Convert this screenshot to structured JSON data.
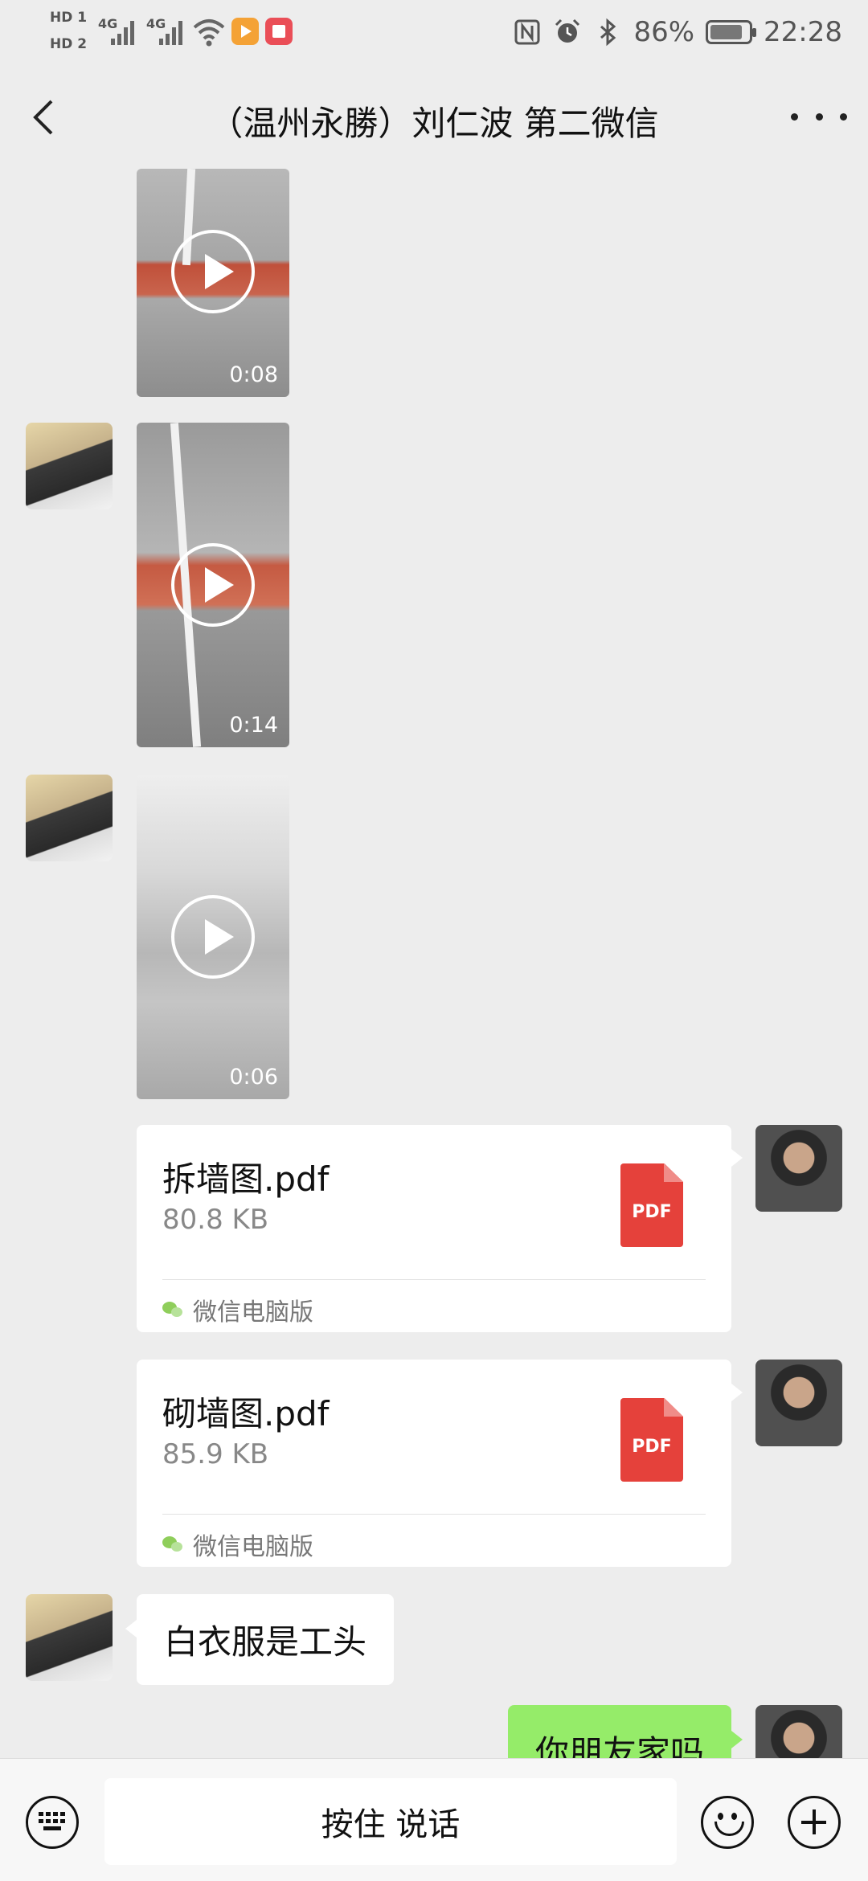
{
  "status_bar": {
    "hd1": "HD 1",
    "hd2": "HD 2",
    "net1": "4G",
    "net2": "4G",
    "battery_percent": "86%",
    "battery_level": 0.86,
    "time": "22:28",
    "icons": [
      "hd-icon",
      "signal-icon",
      "wifi-icon",
      "app-notification-icon",
      "nfc-icon",
      "alarm-icon",
      "bluetooth-icon",
      "battery-icon"
    ]
  },
  "header": {
    "title": "（温州永勝）刘仁波 第二微信"
  },
  "messages": [
    {
      "type": "video",
      "side": "left",
      "duration": "0:08"
    },
    {
      "type": "video",
      "side": "left",
      "duration": "0:14"
    },
    {
      "type": "video",
      "side": "left",
      "duration": "0:06"
    },
    {
      "type": "file",
      "side": "right",
      "name": "拆墙图.pdf",
      "size": "80.8 KB",
      "icon_label": "PDF",
      "source": "微信电脑版"
    },
    {
      "type": "file",
      "side": "right",
      "name": "砌墙图.pdf",
      "size": "85.9 KB",
      "icon_label": "PDF",
      "source": "微信电脑版"
    },
    {
      "type": "text",
      "side": "left",
      "text": "白衣服是工头"
    },
    {
      "type": "text",
      "side": "right",
      "text": "你朋友家吗"
    }
  ],
  "input_bar": {
    "voice_label": "按住 说话"
  },
  "colors": {
    "background": "#ededed",
    "sent_bubble": "#95ec69",
    "pdf_red": "#e5413b"
  }
}
